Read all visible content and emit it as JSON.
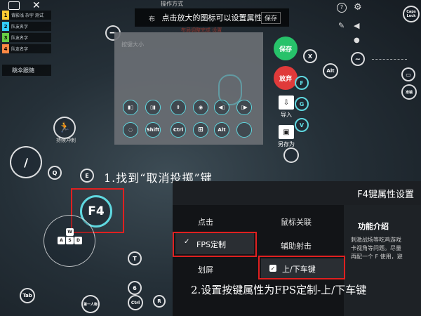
{
  "team_panel": {
    "rows": [
      {
        "num": "1",
        "label": "背影浅 杂宇 测试",
        "color": "#ffcc33"
      },
      {
        "num": "2",
        "label": "队友名字",
        "color": "#33ccff"
      },
      {
        "num": "3",
        "label": "队友名字",
        "color": "#66cc44"
      },
      {
        "num": "4",
        "label": "队友名字",
        "color": "#ff8844"
      }
    ],
    "follow_label": "跳伞跟随"
  },
  "top_bar": {
    "op_title": "操作方式",
    "left_text": "布",
    "hint": "点击放大的图标可以设置属性",
    "save": "保存",
    "red_note": "布局调整完成 设置"
  },
  "popup": {
    "ghost_text": "按键大小",
    "keys_row1": [
      "",
      "",
      "",
      "",
      "",
      ""
    ],
    "keys_row2": [
      "",
      "Shift",
      "Ctrl",
      "",
      "Alt",
      ""
    ]
  },
  "side_buttons": {
    "save": "保存",
    "discard": "放弃",
    "import": "导入",
    "save_as": "另存为"
  },
  "keys": {
    "x": "X",
    "alt": "Alt",
    "f": "F",
    "g": "G",
    "v": "V",
    "q": "Q",
    "e": "E",
    "t": "T",
    "r": "R",
    "tab": "Tab",
    "six": "6",
    "ctrl": "Ctrl",
    "f4": "F4",
    "w": "W",
    "a": "A",
    "s": "S",
    "d": "D",
    "caps": "Caps Lock",
    "hold_sprint": "持续冲刺",
    "first_person": "第一人称",
    "aim": "准镜"
  },
  "annotations": {
    "step1": "1.找到“取消投掷”键",
    "step2": "2.设置按键属性为FPS定制-上/下车键"
  },
  "settings": {
    "title": "F4键属性设置",
    "tabs_left": [
      "点击",
      "FPS定制",
      "划屏"
    ],
    "tabs_mid": [
      "鼠标关联",
      "辅助射击",
      "上/下车键"
    ],
    "func_title": "功能介绍",
    "func_desc": [
      "刺激战场等吃鸡游戏",
      "卡视角等问题。尽量",
      "再配一个 F 使用，避"
    ]
  },
  "colors": {
    "accent": "#5fd8e0",
    "annotation_red": "#e02020",
    "save_green": "#27c26a",
    "discard_red": "#e03a3a"
  }
}
